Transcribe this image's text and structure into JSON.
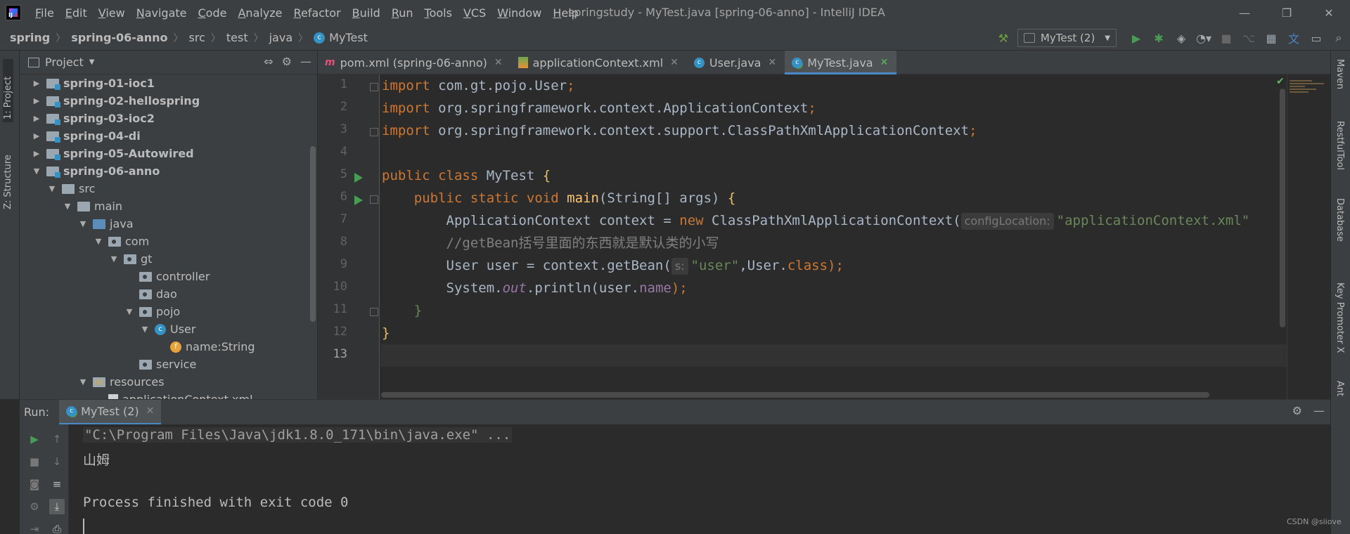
{
  "window": {
    "title": "springstudy - MyTest.java [spring-06-anno] - IntelliJ IDEA",
    "menu": [
      "File",
      "Edit",
      "View",
      "Navigate",
      "Code",
      "Analyze",
      "Refactor",
      "Build",
      "Run",
      "Tools",
      "VCS",
      "Window",
      "Help"
    ],
    "controls": {
      "minimize": "—",
      "restore": "❐",
      "close": "✕"
    }
  },
  "breadcrumb": [
    "spring",
    "spring-06-anno",
    "src",
    "test",
    "java",
    "MyTest"
  ],
  "toolbar": {
    "run_config": "MyTest (2)",
    "icons": [
      "hammer-icon",
      "run-icon",
      "debug-icon",
      "coverage-icon",
      "profile-icon",
      "stop-icon",
      "vcs-icon",
      "project-structure-icon",
      "translate-icon",
      "layout-icon",
      "search-icon"
    ]
  },
  "left_stripe": {
    "project_tab": "1: Project",
    "structure_tab": "Z: Structure"
  },
  "project_panel": {
    "title": "Project",
    "tree": [
      {
        "label": "spring-01-ioc1",
        "depth": 0,
        "icon": "module",
        "arrow": "▶",
        "bold": true
      },
      {
        "label": "spring-02-hellospring",
        "depth": 0,
        "icon": "module",
        "arrow": "▶",
        "bold": true
      },
      {
        "label": "spring-03-ioc2",
        "depth": 0,
        "icon": "module",
        "arrow": "▶",
        "bold": true
      },
      {
        "label": "spring-04-di",
        "depth": 0,
        "icon": "module",
        "arrow": "▶",
        "bold": true
      },
      {
        "label": "spring-05-Autowired",
        "depth": 0,
        "icon": "module",
        "arrow": "▶",
        "bold": true
      },
      {
        "label": "spring-06-anno",
        "depth": 0,
        "icon": "module",
        "arrow": "▼",
        "bold": true
      },
      {
        "label": "src",
        "depth": 1,
        "icon": "folder",
        "arrow": "▼",
        "bold": false
      },
      {
        "label": "main",
        "depth": 2,
        "icon": "folder",
        "arrow": "▼",
        "bold": false
      },
      {
        "label": "java",
        "depth": 3,
        "icon": "src",
        "arrow": "▼",
        "bold": false
      },
      {
        "label": "com",
        "depth": 4,
        "icon": "pkg",
        "arrow": "▼",
        "bold": false
      },
      {
        "label": "gt",
        "depth": 5,
        "icon": "pkg",
        "arrow": "▼",
        "bold": false
      },
      {
        "label": "controller",
        "depth": 6,
        "icon": "pkg",
        "arrow": "",
        "bold": false
      },
      {
        "label": "dao",
        "depth": 6,
        "icon": "pkg",
        "arrow": "",
        "bold": false
      },
      {
        "label": "pojo",
        "depth": 6,
        "icon": "pkg",
        "arrow": "▼",
        "bold": false
      },
      {
        "label": "User",
        "depth": 7,
        "icon": "cls",
        "arrow": "▼",
        "bold": false
      },
      {
        "label": "name:String",
        "depth": 8,
        "icon": "field",
        "arrow": "",
        "bold": false
      },
      {
        "label": "service",
        "depth": 6,
        "icon": "pkg",
        "arrow": "",
        "bold": false
      },
      {
        "label": "resources",
        "depth": 3,
        "icon": "res",
        "arrow": "▼",
        "bold": false
      },
      {
        "label": "applicationContext.xml",
        "depth": 4,
        "icon": "xml",
        "arrow": "",
        "bold": false
      }
    ]
  },
  "editor": {
    "tabs": [
      {
        "label": "pom.xml (spring-06-anno)",
        "icon": "m",
        "active": false
      },
      {
        "label": "applicationContext.xml",
        "icon": "xml",
        "active": false
      },
      {
        "label": "User.java",
        "icon": "c",
        "active": false
      },
      {
        "label": "MyTest.java",
        "icon": "crun",
        "active": true
      }
    ],
    "line_numbers": [
      "1",
      "2",
      "3",
      "4",
      "5",
      "6",
      "7",
      "8",
      "9",
      "10",
      "11",
      "12",
      "13"
    ],
    "current_line": "13",
    "code": {
      "l1_kw": "import",
      "l1_rest": " com.gt.pojo.User",
      "l2_kw": "import",
      "l2_rest": " org.springframework.context.ApplicationContext",
      "l3_kw": "import",
      "l3_rest": " org.springframework.context.support.ClassPathXmlApplicationContext",
      "semi": ";",
      "l5_kw": "public class",
      "l5_name": " MyTest ",
      "l5_brace": "{",
      "l6_kw": "public static void",
      "l6_fn": "main",
      "l6_rest": "(String[] args) ",
      "l6_brace": "{",
      "l7_a": "ApplicationContext context = ",
      "l7_kw": "new",
      "l7_b": " ClassPathXmlApplicationContext(",
      "l7_hint": "configLocation:",
      "l7_str": "\"applicationContext.xml\"",
      "l8_cmt": "//getBean括号里面的东西就是默认类的小写",
      "l9_a": "User user = context.getBean(",
      "l9_hint": "s:",
      "l9_str": "\"user\"",
      "l9_b": ",User.",
      "l9_kw": "class",
      "l9_c": ");",
      "l10_a": "System.",
      "l10_out": "out",
      "l10_b": ".println(user.",
      "l10_fld": "name",
      "l10_c": ");",
      "l11": "}",
      "l12": "}"
    }
  },
  "right_stripe": [
    "Maven",
    "RestfulTool",
    "Database",
    "Key Promoter X",
    "Ant"
  ],
  "run_panel": {
    "label": "Run:",
    "tab": "MyTest (2)",
    "console": [
      "\"C:\\Program Files\\Java\\jdk1.8.0_171\\bin\\java.exe\" ...",
      "山姆",
      "",
      "Process finished with exit code 0"
    ]
  },
  "watermark": "CSDN @siiove"
}
